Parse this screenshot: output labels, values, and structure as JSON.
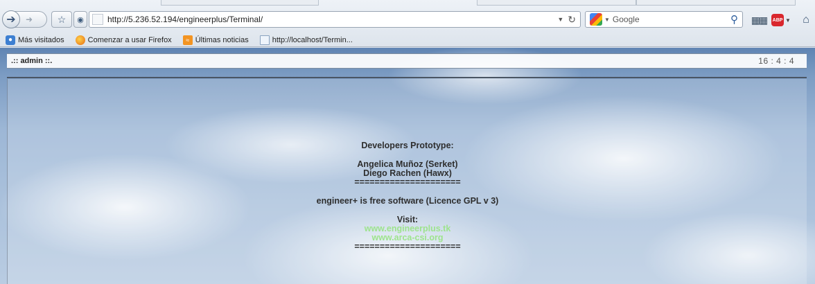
{
  "browser": {
    "url": "http://5.236.52.194/engineerplus/Terminal/",
    "search_placeholder": "Google",
    "bookmarks": [
      {
        "label": "Más visitados",
        "icon": "most-visited-icon"
      },
      {
        "label": "Comenzar a usar Firefox",
        "icon": "firefox-icon"
      },
      {
        "label": "Últimas noticias",
        "icon": "rss-icon"
      },
      {
        "label": "http://localhost/Termin...",
        "icon": "page-icon"
      }
    ]
  },
  "header": {
    "user_label": ".:: admin ::.",
    "clock": "16 : 4 : 4"
  },
  "credits": {
    "heading": "Developers Prototype:",
    "dev1": "Angelica Muñoz (Serket)",
    "dev2": "Diego Rachen (Hawx)",
    "divider": "=====================",
    "license": "engineer+ is free software (Licence GPL v 3)",
    "visit_label": "Visit:",
    "link1": "www.engineerplus.tk",
    "link2": "www.arca-csi.org",
    "divider2": "====================="
  },
  "colors": {
    "link": "#9de38d",
    "text": "#2e2e2e"
  }
}
